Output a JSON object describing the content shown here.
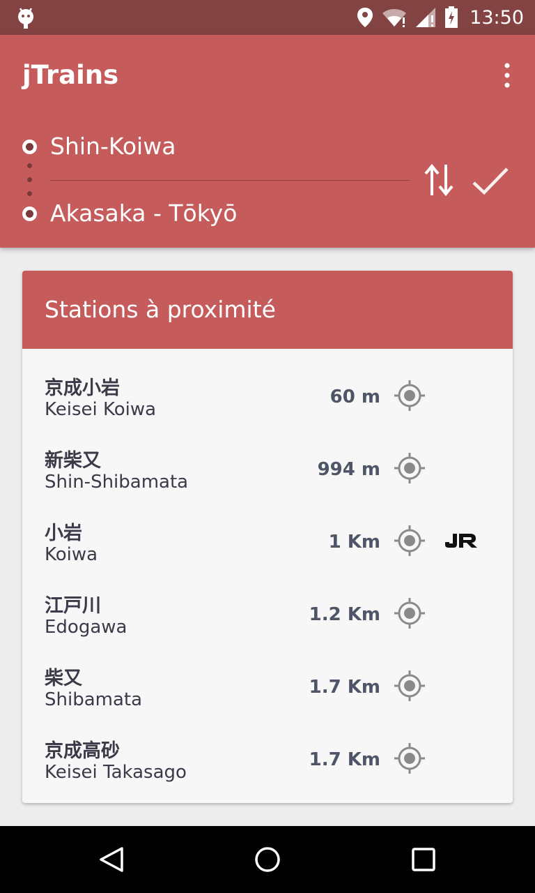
{
  "status_bar": {
    "time": "13:50"
  },
  "app_bar": {
    "title": "jTrains",
    "from_station": "Shin-Koiwa",
    "to_station": "Akasaka - Tōkyō"
  },
  "nearby": {
    "title": "Stations à proximité",
    "stations": [
      {
        "jp": "京成小岩",
        "romaji": "Keisei Koiwa",
        "distance": "60 m"
      },
      {
        "jp": "新柴又",
        "romaji": "Shin-Shibamata",
        "distance": "994 m"
      },
      {
        "jp": "小岩",
        "romaji": "Koiwa",
        "distance": "1 Km",
        "badge": "JR"
      },
      {
        "jp": "江戸川",
        "romaji": "Edogawa",
        "distance": "1.2 Km"
      },
      {
        "jp": "柴又",
        "romaji": "Shibamata",
        "distance": "1.7 Km"
      },
      {
        "jp": "京成高砂",
        "romaji": "Keisei Takasago",
        "distance": "1.7 Km"
      }
    ]
  },
  "colors": {
    "primary": "#c55b5b",
    "status_bar": "#844343",
    "card_bg": "#f7f7f7"
  },
  "icons": [
    "android-icon",
    "location-pin-icon",
    "wifi-icon",
    "signal-icon",
    "battery-icon",
    "more-vert-icon",
    "swap-icon",
    "check-icon",
    "my-location-icon",
    "jr-logo",
    "back-icon",
    "home-icon",
    "recents-icon"
  ]
}
